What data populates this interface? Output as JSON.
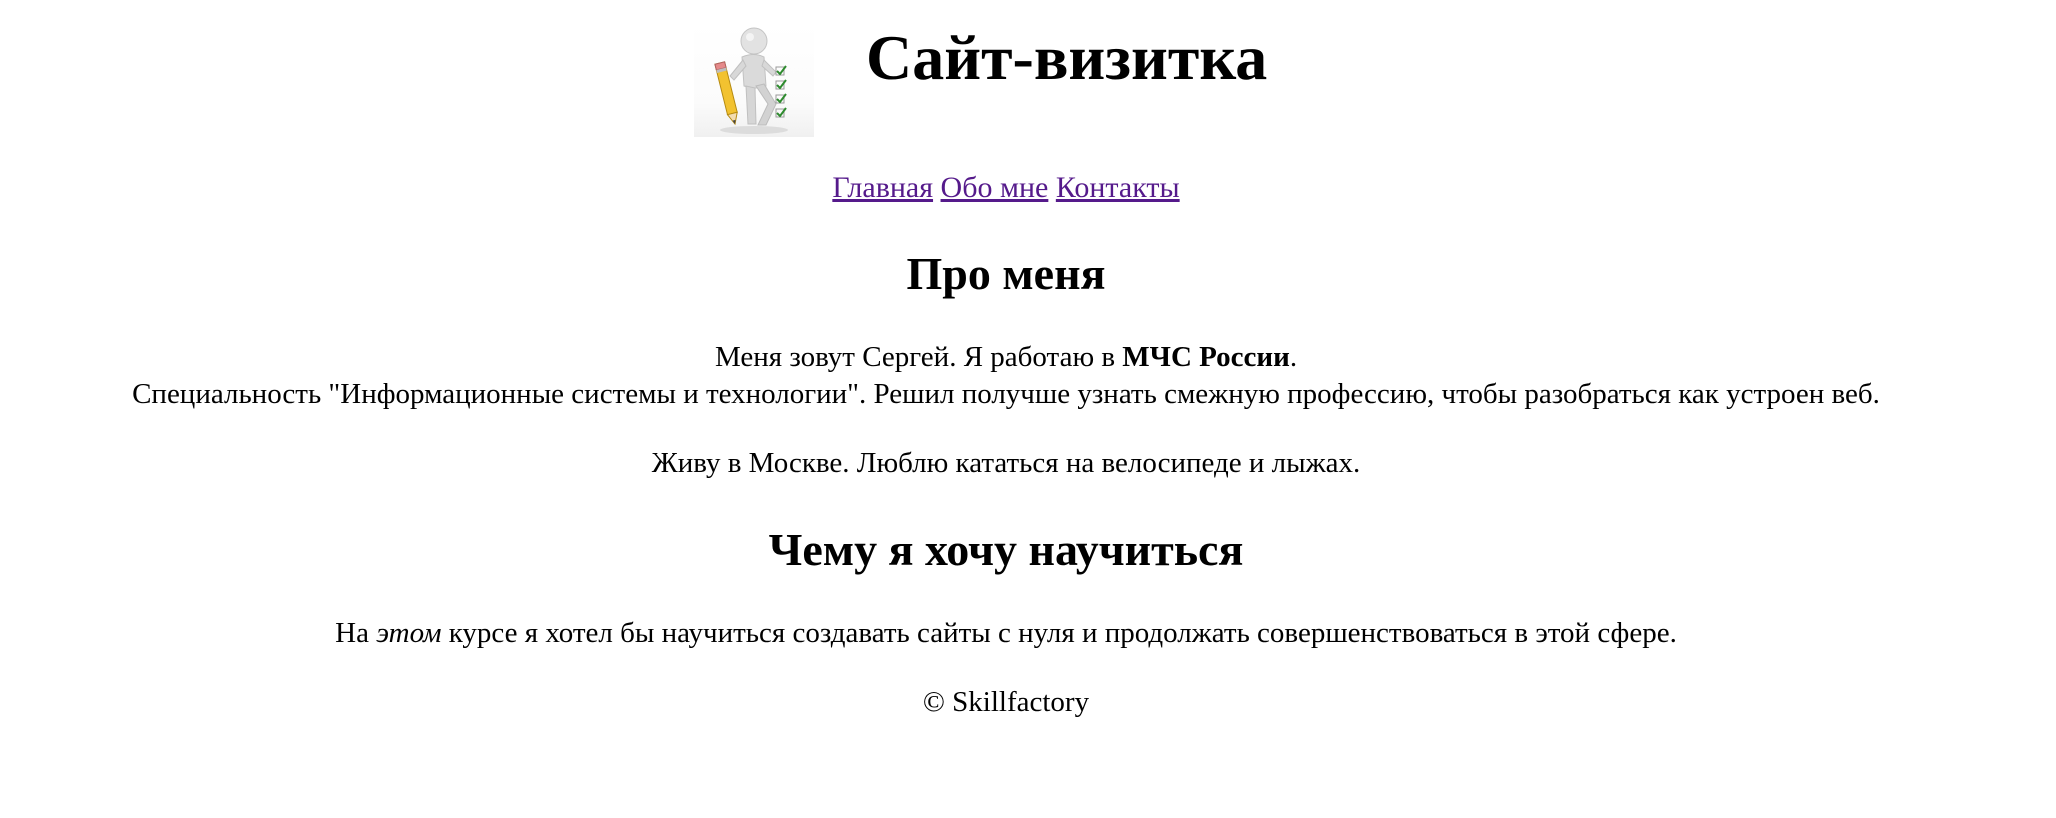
{
  "header": {
    "title": "Сайт-визитка",
    "logo_icon": "person-with-pencil-checklist-icon"
  },
  "nav": {
    "items": [
      {
        "label": "Главная"
      },
      {
        "label": "Обо мне"
      },
      {
        "label": "Контакты"
      }
    ]
  },
  "about": {
    "heading": "Про меня",
    "p1_text_before": "Меня зовут Сергей. Я работаю в ",
    "p1_strong": "МЧС России",
    "p1_text_after": ".",
    "p1_line2": "Специальность \"Информационные системы и технологии\". Решил получше узнать смежную профессию, чтобы разобраться как устроен веб.",
    "p2": "Живу в Москве. Люблю кататься на велосипеде и лыжах."
  },
  "learn": {
    "heading": "Чему я хочу научиться",
    "text_before": "На ",
    "emphasis": "этом",
    "text_after": " курсе я хотел бы научиться создавать сайты с нуля и продолжать совершенствоваться в этой сфере."
  },
  "footer": {
    "copyright": "© Skillfactory"
  },
  "colors": {
    "link": "#551a8b",
    "text": "#000000",
    "background": "#ffffff"
  }
}
